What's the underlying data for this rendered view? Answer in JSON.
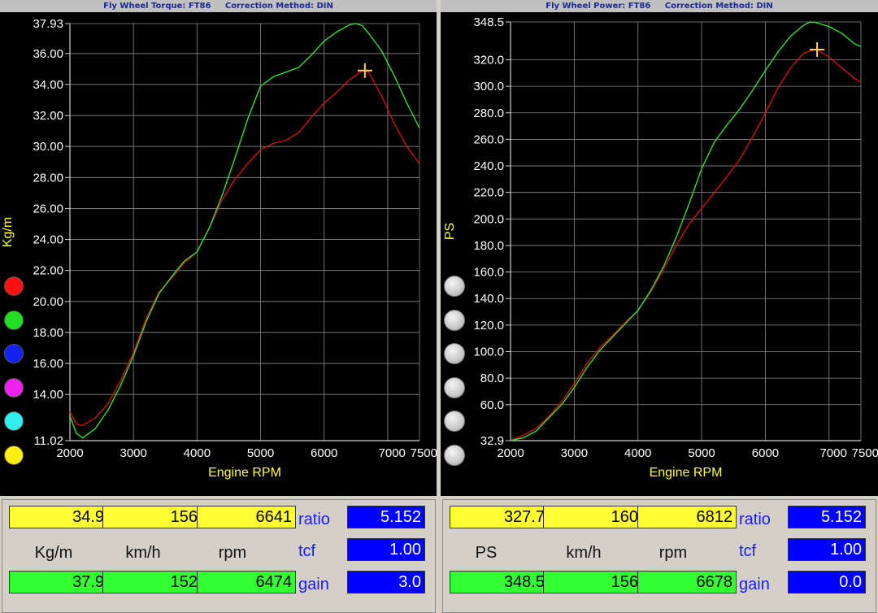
{
  "left": {
    "title": "Fly Wheel Torque: FT86     Correction Method: DIN",
    "chart_data": {
      "type": "line",
      "ylabel": "Kg/m",
      "xlabel": "Engine RPM",
      "xlim": [
        2000,
        7500
      ],
      "ylim": [
        11.02,
        37.93
      ],
      "y_ticks": [
        "37.93",
        "36.00",
        "34.00",
        "32.00",
        "30.00",
        "28.00",
        "26.00",
        "24.00",
        "22.00",
        "20.00",
        "18.00",
        "16.00",
        "14.00",
        "11.02"
      ],
      "x_ticks": [
        "2000",
        "3000",
        "4000",
        "5000",
        "6000",
        "7000",
        "7500"
      ],
      "grid": true,
      "series": [
        {
          "color": "#cc1111",
          "x": [
            2000,
            2100,
            2200,
            2400,
            2600,
            2800,
            3000,
            3200,
            3400,
            3600,
            3800,
            4000,
            4200,
            4400,
            4600,
            4800,
            5000,
            5200,
            5400,
            5600,
            5800,
            6000,
            6200,
            6400,
            6600,
            6700,
            6900,
            7100,
            7300,
            7500
          ],
          "y": [
            12.9,
            12.1,
            12.0,
            12.5,
            13.4,
            14.9,
            16.7,
            18.9,
            20.6,
            21.5,
            22.5,
            23.2,
            24.8,
            26.6,
            27.9,
            28.9,
            29.8,
            30.2,
            30.4,
            30.9,
            31.9,
            32.8,
            33.5,
            34.3,
            34.9,
            34.8,
            33.3,
            31.5,
            30.0,
            28.9
          ]
        },
        {
          "color": "#33dd33",
          "x": [
            2000,
            2100,
            2200,
            2400,
            2600,
            2800,
            3000,
            3200,
            3400,
            3600,
            3800,
            4000,
            4200,
            4400,
            4600,
            4800,
            5000,
            5200,
            5400,
            5600,
            5800,
            6000,
            6200,
            6400,
            6500,
            6600,
            6700,
            6900,
            7100,
            7300,
            7500
          ],
          "y": [
            12.6,
            11.5,
            11.2,
            11.8,
            13.0,
            14.6,
            16.5,
            18.7,
            20.5,
            21.6,
            22.6,
            23.2,
            24.8,
            26.9,
            29.3,
            31.8,
            33.9,
            34.5,
            34.8,
            35.1,
            35.9,
            36.8,
            37.4,
            37.85,
            37.93,
            37.8,
            37.3,
            36.2,
            34.6,
            32.8,
            31.2
          ]
        }
      ],
      "cursor": {
        "x": 6641,
        "y": 34.9
      }
    },
    "legend_colors": [
      "#ff1111",
      "#22dd22",
      "#1122ee",
      "#ee22ee",
      "#33eeee",
      "#ffee11"
    ],
    "readout": {
      "top": [
        "34.9",
        "156",
        "6641"
      ],
      "units": [
        "Kg/m",
        "km/h",
        "rpm"
      ],
      "bottom": [
        "37.9",
        "152",
        "6474"
      ],
      "ratio_label": "ratio",
      "ratio": "5.152",
      "tcf_label": "tcf",
      "tcf": "1.00",
      "gain_label": "gain",
      "gain": "3.0"
    }
  },
  "right": {
    "title": "Fly Wheel Power: FT86     Correction Method: DIN",
    "chart_data": {
      "type": "line",
      "ylabel": "PS",
      "xlabel": "Engine RPM",
      "xlim": [
        2000,
        7500
      ],
      "ylim": [
        32.9,
        348.5
      ],
      "y_ticks": [
        "348.5",
        "320.0",
        "300.0",
        "280.0",
        "260.0",
        "240.0",
        "220.0",
        "200.0",
        "180.0",
        "160.0",
        "140.0",
        "120.0",
        "100.0",
        "80.0",
        "60.0",
        "32.9"
      ],
      "x_ticks": [
        "2000",
        "3000",
        "4000",
        "5000",
        "6000",
        "7000",
        "7500"
      ],
      "grid": true,
      "series": [
        {
          "color": "#cc1111",
          "x": [
            2000,
            2200,
            2400,
            2600,
            2800,
            3000,
            3200,
            3400,
            3600,
            3800,
            4000,
            4200,
            4400,
            4600,
            4800,
            5000,
            5200,
            5400,
            5600,
            5800,
            6000,
            6200,
            6400,
            6600,
            6800,
            7000,
            7200,
            7400,
            7500
          ],
          "y": [
            33,
            37,
            42,
            51,
            62,
            76,
            91,
            103,
            112,
            122,
            131,
            145,
            162,
            180,
            196,
            208,
            220,
            232,
            245,
            262,
            280,
            299,
            314,
            325,
            328,
            322,
            314,
            306,
            303
          ]
        },
        {
          "color": "#33dd33",
          "x": [
            2000,
            2200,
            2400,
            2600,
            2800,
            3000,
            3200,
            3400,
            3600,
            3800,
            4000,
            4200,
            4400,
            4600,
            4800,
            5000,
            5200,
            5400,
            5600,
            5800,
            6000,
            6200,
            6400,
            6600,
            6700,
            6800,
            7000,
            7200,
            7400,
            7500
          ],
          "y": [
            33,
            35,
            40,
            50,
            60,
            73,
            88,
            101,
            111,
            121,
            131,
            146,
            164,
            186,
            211,
            238,
            258,
            271,
            283,
            297,
            312,
            326,
            338,
            346,
            348.5,
            348,
            345,
            340,
            332,
            330
          ]
        }
      ],
      "cursor": {
        "x": 6812,
        "y": 327.7
      }
    },
    "readout": {
      "top": [
        "327.7",
        "160",
        "6812"
      ],
      "units": [
        "PS",
        "km/h",
        "rpm"
      ],
      "bottom": [
        "348.5",
        "156",
        "6678"
      ],
      "ratio_label": "ratio",
      "ratio": "5.152",
      "tcf_label": "tcf",
      "tcf": "1.00",
      "gain_label": "gain",
      "gain": "0.0"
    }
  }
}
